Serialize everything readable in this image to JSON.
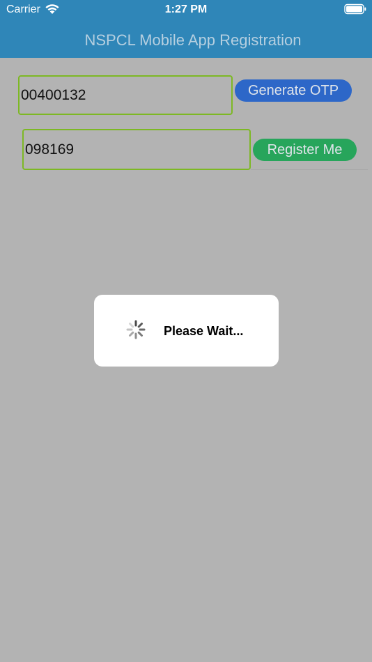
{
  "status_bar": {
    "carrier": "Carrier",
    "time": "1:27 PM",
    "wifi_icon": "wifi-icon",
    "battery_icon": "battery-icon"
  },
  "nav": {
    "title": "NSPCL Mobile App Registration"
  },
  "form": {
    "mobile_value": "00400132",
    "otp_value": "098169",
    "generate_otp_label": "Generate OTP",
    "register_label": "Register Me"
  },
  "dialog": {
    "message": "Please Wait...",
    "spinner_icon": "spinner-icon"
  },
  "colors": {
    "nav_bar": "#2f86b8",
    "overlay_background": "#b3b3b3",
    "field_border": "#7db824",
    "generate_otp_button": "#2d67c8",
    "register_button": "#27a55b"
  }
}
